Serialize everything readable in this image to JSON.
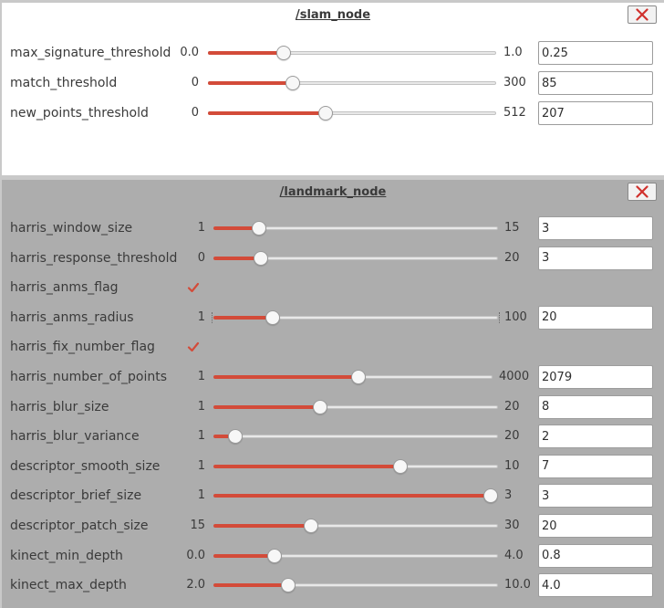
{
  "colors": {
    "accent": "#d34b39",
    "slam_panel_bg": "#ffffff",
    "landmark_panel_bg": "#adadad",
    "close_x": "#d0312d"
  },
  "slam_node": {
    "title": "/slam_node",
    "close_icon": "close-icon",
    "params": [
      {
        "label": "max_signature_threshold",
        "min": "0.0",
        "max": "1.0",
        "value": "0.25",
        "position": 0.25
      },
      {
        "label": "match_threshold",
        "min": "0",
        "max": "300",
        "value": "85",
        "position": 0.283
      },
      {
        "label": "new_points_threshold",
        "min": "0",
        "max": "512",
        "value": "207",
        "position": 0.404
      }
    ]
  },
  "landmark_node": {
    "title": "/landmark_node",
    "close_icon": "close-icon",
    "params": [
      {
        "label": "harris_window_size",
        "type": "slider",
        "min": "1",
        "max": "15",
        "value": "3",
        "position": 0.143
      },
      {
        "label": "harris_response_threshold",
        "type": "slider",
        "min": "0",
        "max": "20",
        "value": "3",
        "position": 0.15
      },
      {
        "label": "harris_anms_flag",
        "type": "checkbox",
        "checked": true
      },
      {
        "label": "harris_anms_radius",
        "type": "slider",
        "min": "1",
        "max": "100",
        "value": "20",
        "position": 0.192
      },
      {
        "label": "harris_fix_number_flag",
        "type": "checkbox",
        "checked": true
      },
      {
        "label": "harris_number_of_points",
        "type": "slider",
        "min": "1",
        "max": "4000",
        "value": "2079",
        "position": 0.52
      },
      {
        "label": "harris_blur_size",
        "type": "slider",
        "min": "1",
        "max": "20",
        "value": "8",
        "position": 0.368
      },
      {
        "label": "harris_blur_variance",
        "type": "slider",
        "min": "1",
        "max": "20",
        "value": "2",
        "position": 0.053
      },
      {
        "label": "descriptor_smooth_size",
        "type": "slider",
        "min": "1",
        "max": "10",
        "value": "7",
        "position": 0.667
      },
      {
        "label": "descriptor_brief_size",
        "type": "slider",
        "min": "1",
        "max": "3",
        "value": "3",
        "position": 1.0
      },
      {
        "label": "descriptor_patch_size",
        "type": "slider",
        "min": "15",
        "max": "30",
        "value": "20",
        "position": 0.333
      },
      {
        "label": "kinect_min_depth",
        "type": "slider",
        "min": "0.0",
        "max": "4.0",
        "value": "0.8",
        "position": 0.2
      },
      {
        "label": "kinect_max_depth",
        "type": "slider",
        "min": "2.0",
        "max": "10.0",
        "value": "4.0",
        "position": 0.25
      }
    ]
  }
}
